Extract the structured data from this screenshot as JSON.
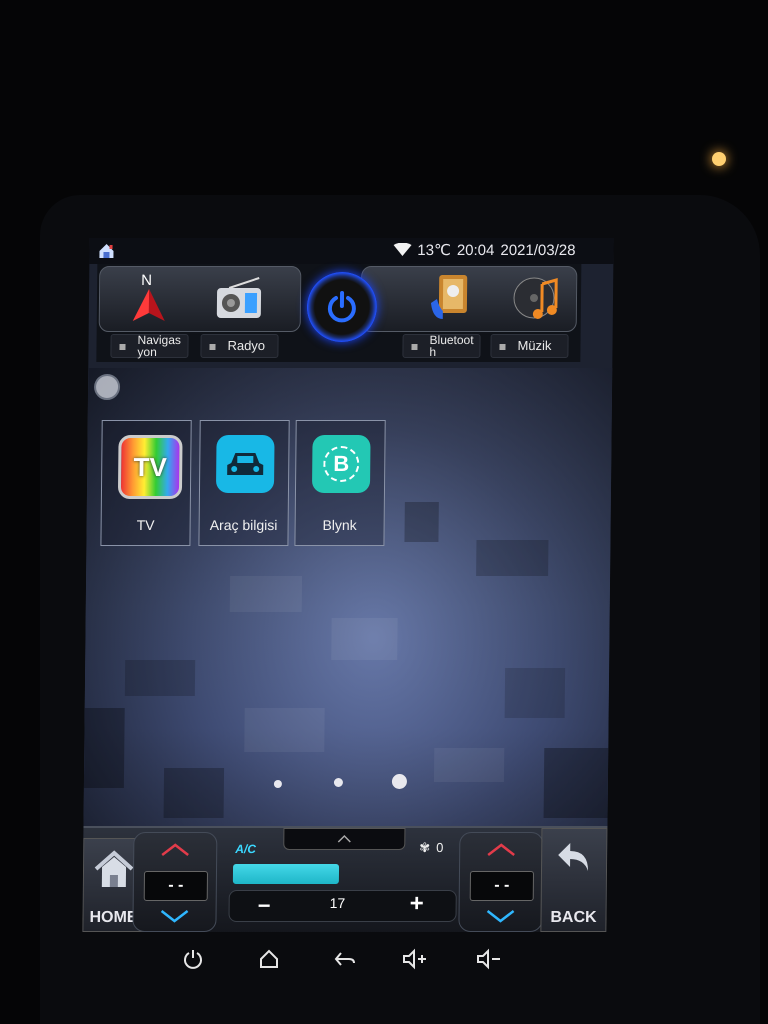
{
  "status": {
    "temperature": "13℃",
    "time": "20:04",
    "date": "2021/03/28"
  },
  "dock": {
    "items": [
      {
        "label": "Navigas\nyon",
        "label_line1": "Navigas",
        "label_line2": "yon",
        "icon": "compass-icon"
      },
      {
        "label": "Radyo",
        "label_line1": "Radyo",
        "label_line2": "",
        "icon": "radio-icon"
      },
      {
        "label": "Bluetoot\nh",
        "label_line1": "Bluetoot",
        "label_line2": "h",
        "icon": "bluetooth-phone-icon"
      },
      {
        "label": "Müzik",
        "label_line1": "Müzik",
        "label_line2": "",
        "icon": "music-icon"
      }
    ],
    "compass_letter": "N"
  },
  "apps": [
    {
      "label": "TV",
      "icon": "tv-icon",
      "icon_text": "TV"
    },
    {
      "label": "Araç bilgisi",
      "icon": "car-icon"
    },
    {
      "label": "Blynk",
      "icon": "blynk-icon",
      "icon_text": "B"
    }
  ],
  "pager": {
    "pages": 3,
    "active_page": 3
  },
  "climate": {
    "home_label": "HOME",
    "back_label": "BACK",
    "left_temp": "- -",
    "right_temp": "- -",
    "ac_label": "A/C",
    "fan_level": "0",
    "speed_value": "17",
    "minus_label": "−",
    "plus_label": "+"
  },
  "colors": {
    "accent_blue": "#1d46ff",
    "fan_bar": "#2fc6d6",
    "up_arrow": "#e23b4a",
    "down_arrow": "#2fb7ff"
  }
}
